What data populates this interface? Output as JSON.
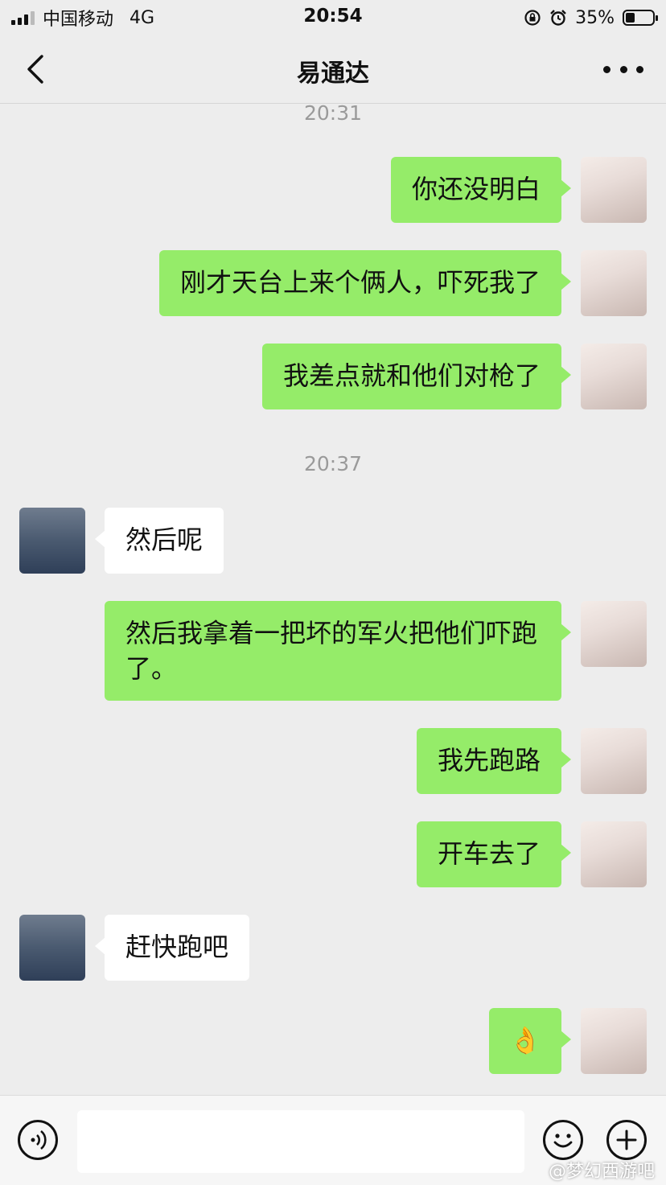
{
  "status_bar": {
    "carrier": "中国移动",
    "network": "4G",
    "time": "20:54",
    "battery": "35%",
    "battery_level": 0.35
  },
  "nav": {
    "title": "易通达",
    "back_icon": "chevron-left-icon",
    "more_icon": "more-dots-icon"
  },
  "timestamps": [
    "20:31",
    "20:37"
  ],
  "messages": [
    {
      "sender": "me",
      "text": "你还没明白"
    },
    {
      "sender": "me",
      "text": "刚才天台上来个俩人，吓死我了"
    },
    {
      "sender": "me",
      "text": "我差点就和他们对枪了"
    },
    {
      "sender": "other",
      "text": "然后呢"
    },
    {
      "sender": "me",
      "text": "然后我拿着一把坏的军火把他们吓跑了。"
    },
    {
      "sender": "me",
      "text": "我先跑路"
    },
    {
      "sender": "me",
      "text": "开车去了"
    },
    {
      "sender": "other",
      "text": "赶快跑吧"
    },
    {
      "sender": "me",
      "text": "👌"
    }
  ],
  "input_bar": {
    "voice_icon": "voice-icon",
    "emoji_icon": "emoji-icon",
    "plus_icon": "plus-icon",
    "input_value": ""
  },
  "watermark": "@梦幻西游吧",
  "colors": {
    "background": "#ededed",
    "my_bubble": "#95ec69",
    "other_bubble": "#ffffff",
    "timestamp": "#9a9a9a"
  }
}
